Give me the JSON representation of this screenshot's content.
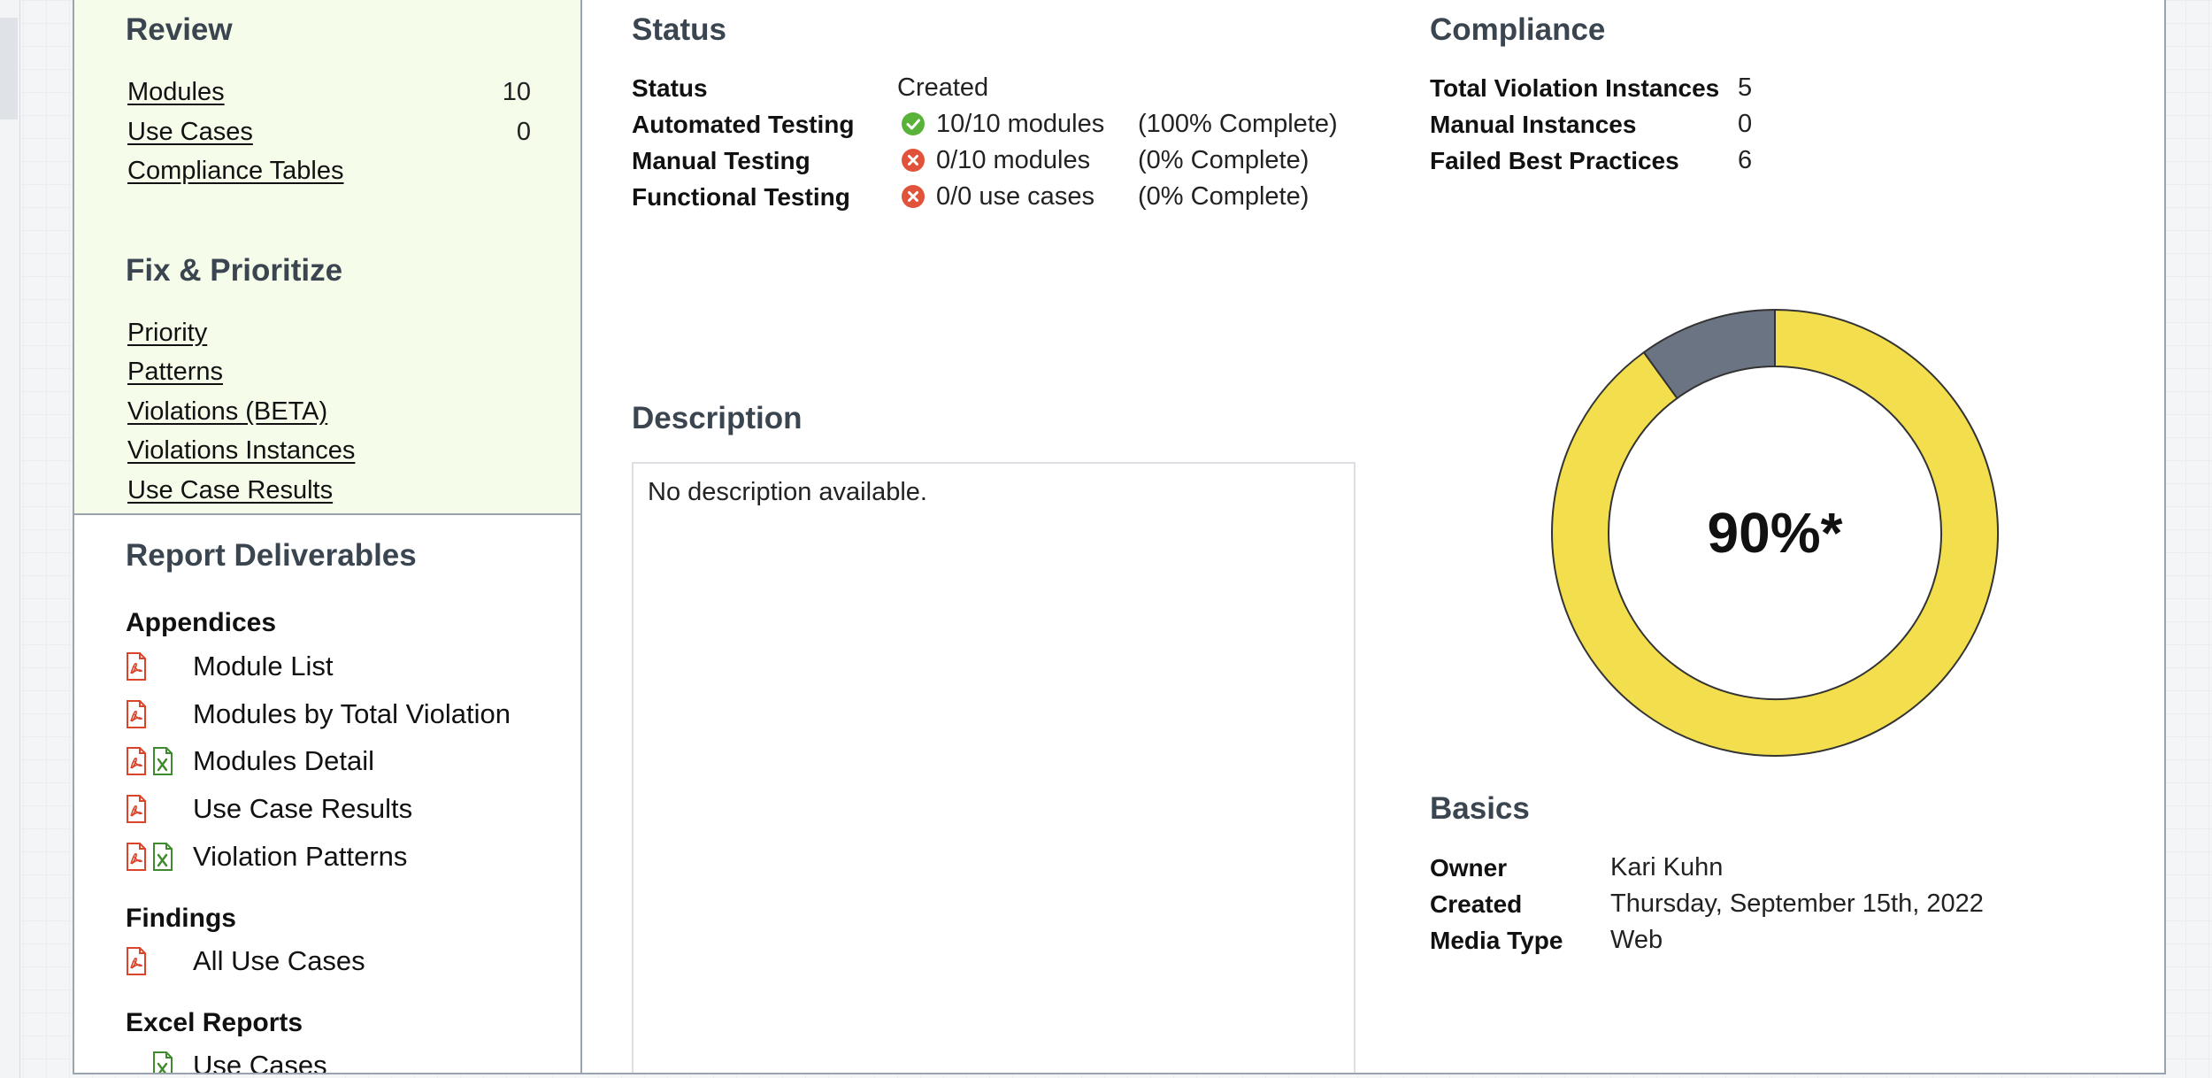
{
  "sidebar": {
    "review": {
      "heading": "Review",
      "items": [
        {
          "label": "Modules",
          "count": "10"
        },
        {
          "label": "Use Cases",
          "count": "0"
        },
        {
          "label": "Compliance Tables"
        }
      ]
    },
    "fix": {
      "heading": "Fix & Prioritize",
      "items": [
        {
          "label": "Priority"
        },
        {
          "label": "Patterns"
        },
        {
          "label": "Violations (BETA)"
        },
        {
          "label": "Violations Instances"
        },
        {
          "label": "Use Case Results"
        }
      ]
    },
    "deliverables": {
      "heading": "Report Deliverables",
      "appendices_heading": "Appendices",
      "appendices": [
        {
          "label": "Module List",
          "pdf": "pdf-icon"
        },
        {
          "label": "Modules by Total Violation",
          "pdf": "pdf-icon"
        },
        {
          "label": "Modules Detail",
          "pdf": "pdf-icon",
          "xls": "excel-icon"
        },
        {
          "label": "Use Case Results",
          "pdf": "pdf-icon"
        },
        {
          "label": "Violation Patterns",
          "pdf": "pdf-icon",
          "xls": "excel-icon"
        }
      ],
      "findings_heading": "Findings",
      "findings": [
        {
          "label": "All Use Cases",
          "pdf": "pdf-icon"
        }
      ],
      "excel_heading": "Excel Reports",
      "excel": [
        {
          "label": "Use Cases",
          "xls": "excel-icon"
        }
      ]
    }
  },
  "status": {
    "heading": "Status",
    "rows": [
      {
        "label": "Status",
        "value": "Created"
      },
      {
        "label": "Automated Testing",
        "icon": "check-circle-icon",
        "value": "10/10 modules",
        "pct": "(100% Complete)"
      },
      {
        "label": "Manual Testing",
        "icon": "x-circle-icon",
        "value": "0/10 modules",
        "pct": "(0% Complete)"
      },
      {
        "label": "Functional Testing",
        "icon": "x-circle-icon",
        "value": "0/0 use cases",
        "pct": "(0% Complete)"
      }
    ]
  },
  "description": {
    "heading": "Description",
    "text": "No description available."
  },
  "compliance": {
    "heading": "Compliance",
    "rows": [
      {
        "label": "Total Violation Instances",
        "value": "5"
      },
      {
        "label": "Manual Instances",
        "value": "0"
      },
      {
        "label": "Failed Best Practices",
        "value": "6"
      }
    ],
    "score_label": "90%*",
    "score_fraction": 0.9,
    "colors": {
      "pass": "#f3df4d",
      "fail": "#6b7482",
      "stroke": "#333333"
    }
  },
  "basics": {
    "heading": "Basics",
    "rows": [
      {
        "label": "Owner",
        "value": "Kari Kuhn"
      },
      {
        "label": "Created",
        "value": "Thursday, September 15th, 2022"
      },
      {
        "label": "Media Type",
        "value": "Web"
      }
    ]
  },
  "colors": {
    "pdf": "#d9442b",
    "excel": "#3f8a2e",
    "check": "#5ab339",
    "error": "#e0533a"
  }
}
